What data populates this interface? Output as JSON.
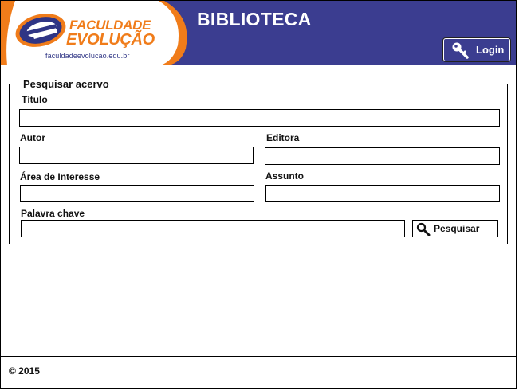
{
  "header": {
    "logo": {
      "name_line1": "FACULDADE",
      "name_line2": "EVOLUÇÃO",
      "url": "faculdadeevolucao.edu.br"
    },
    "title": "BIBLIOTECA",
    "login_label": "Login",
    "background_color": "#3b3d90",
    "accent_color": "#f07c1a"
  },
  "search": {
    "legend": "Pesquisar acervo",
    "fields": {
      "titulo": {
        "label": "Título",
        "value": ""
      },
      "autor": {
        "label": "Autor",
        "value": ""
      },
      "editora": {
        "label": "Editora",
        "value": ""
      },
      "area": {
        "label": "Área de Interesse",
        "value": ""
      },
      "assunto": {
        "label": "Assunto",
        "value": ""
      },
      "palavra": {
        "label": "Palavra chave",
        "value": ""
      }
    },
    "button_label": "Pesquisar"
  },
  "footer": {
    "copyright": "© 2015"
  }
}
